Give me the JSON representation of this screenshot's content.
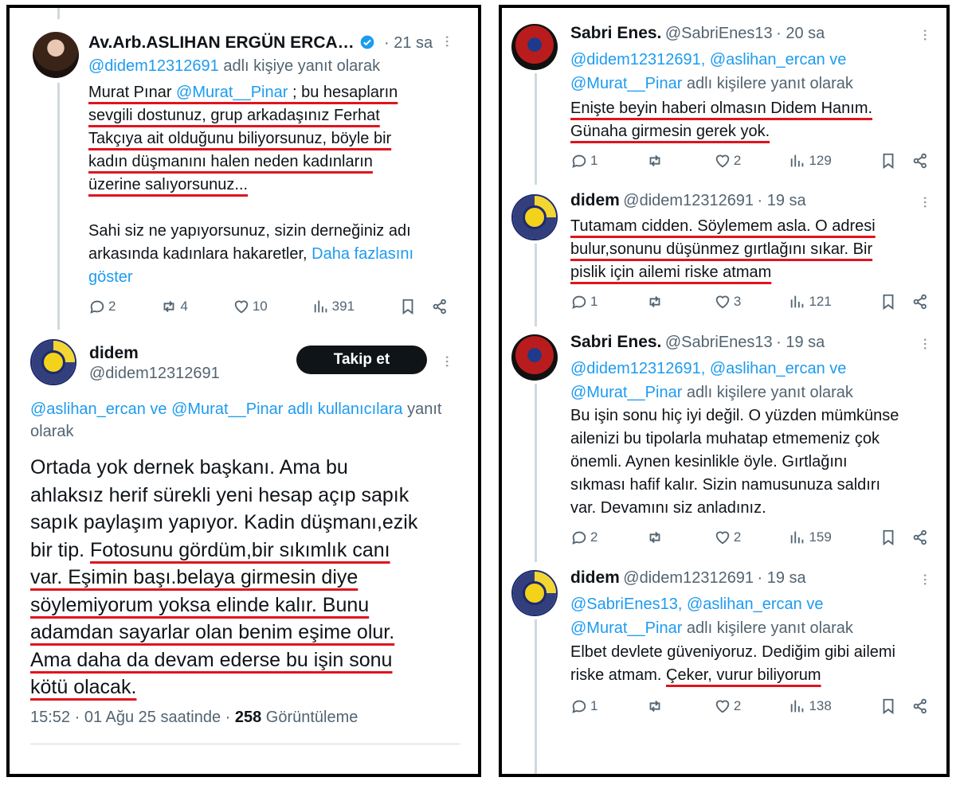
{
  "left": {
    "tweet": {
      "author_name": "Av.Arb.ASLIHAN ERGÜN ERCA…",
      "time": "· 21 sa",
      "reply_handle": "@didem12312691",
      "reply_suffix": " adlı kişiye yanıt olarak",
      "line1_a": "Murat Pınar ",
      "line1_link": "@Murat__Pinar",
      "line1_b": " ; bu hesapların",
      "line2": "sevgili dostunuz, grup arkadaşınız Ferhat",
      "line3": "Takçıya ait olduğunu biliyorsunuz, böyle bir",
      "line4": "kadın düşmanını halen neden kadınların",
      "line5": "üzerine salıyorsunuz...",
      "line6": "Sahi siz ne yapıyorsunuz, sizin derneğiniz adı",
      "line7_a": "arkasında kadınlara hakaretler, ",
      "line7_link": "Daha fazlasını",
      "line8_link": "göster",
      "replies": "2",
      "retweets": "4",
      "likes": "10",
      "views": "391"
    },
    "main": {
      "author_name": "didem",
      "handle": "@didem12312691",
      "follow_label": "Takip et",
      "reply_links": "@aslihan_ercan ve @Murat__Pinar adlı kullanıcılara",
      "reply_suffix": " yanıt",
      "reply_line2": "olarak",
      "lines": [
        "Ortada yok dernek başkanı. Ama bu",
        "ahlaksız herif sürekli yeni hesap açıp sapık",
        "sapık paylaşım yapıyor. Kadin düşmanı,ezik",
        "bir tip. ",
        "Fotosunu gördüm,bir sıkımlık canı",
        "var. Eşimin başı.belaya girmesin diye",
        "söylemiyorum yoksa elinde kalır. Bunu",
        "adamdan sayarlar olan benim eşime olur.",
        "Ama daha da devam ederse bu işin sonu",
        "kötü olacak."
      ],
      "timestamp": "15:52 · 01 Ağu 25 saatinde · ",
      "views_count": "258",
      "views_label": " Görüntüleme"
    }
  },
  "right": {
    "tweets": [
      {
        "name": "Sabri Enes.",
        "handle": "@SabriEnes13",
        "time": "· 20 sa",
        "reply_links_1": "@didem12312691, @aslihan_ercan ve",
        "reply_links_2": "@Murat__Pinar",
        "reply_suffix": " adlı kişilere yanıt olarak",
        "body": [
          "Enişte beyin haberi olmasın Didem Hanım.",
          "Günaha girmesin gerek yok."
        ],
        "replies": "1",
        "retweets": "",
        "likes": "2",
        "views": "129"
      },
      {
        "name": "didem",
        "handle": "@didem12312691",
        "time": "· 19 sa",
        "body": [
          "Tutamam cidden. Söylemem asla. O adresi",
          "bulur,sonunu düşünmez gırtlağını sıkar. Bir",
          "pislik için ailemi riske atmam"
        ],
        "replies": "1",
        "retweets": "",
        "likes": "3",
        "views": "121"
      },
      {
        "name": "Sabri Enes.",
        "handle": "@SabriEnes13",
        "time": "· 19 sa",
        "reply_links_1": "@didem12312691, @aslihan_ercan ve",
        "reply_links_2": "@Murat__Pinar",
        "reply_suffix": " adlı kişilere yanıt olarak",
        "body": [
          "Bu işin sonu hiç iyi değil. O yüzden mümkünse",
          "ailenizi bu tipolarla muhatap etmemeniz çok",
          "önemli. Aynen kesinlikle öyle. Gırtlağını",
          "sıkması hafif kalır. Sizin namusunuza saldırı",
          "var. Devamını siz anladınız."
        ],
        "replies": "2",
        "retweets": "",
        "likes": "2",
        "views": "159"
      },
      {
        "name": "didem",
        "handle": "@didem12312691",
        "time": "· 19 sa",
        "reply_links_1": "@SabriEnes13, @aslihan_ercan ve",
        "reply_links_2": "@Murat__Pinar",
        "reply_suffix": " adlı kişilere yanıt olarak",
        "body_1": "Elbet devlete güveniyoruz. Dediğim gibi ailemi",
        "body_2a": "riske atmam. ",
        "body_2b": "Çeker, vurur biliyorum",
        "replies": "1",
        "retweets": "",
        "likes": "2",
        "views": "138"
      }
    ]
  },
  "colors": {
    "link": "#1d9bf0",
    "underline": "#e0141e",
    "muted": "#536471",
    "verified": "#1d9bf0"
  },
  "icons": [
    "reply-icon",
    "retweet-icon",
    "like-icon",
    "views-icon",
    "bookmark-icon",
    "share-icon",
    "more-icon",
    "verified-icon"
  ]
}
